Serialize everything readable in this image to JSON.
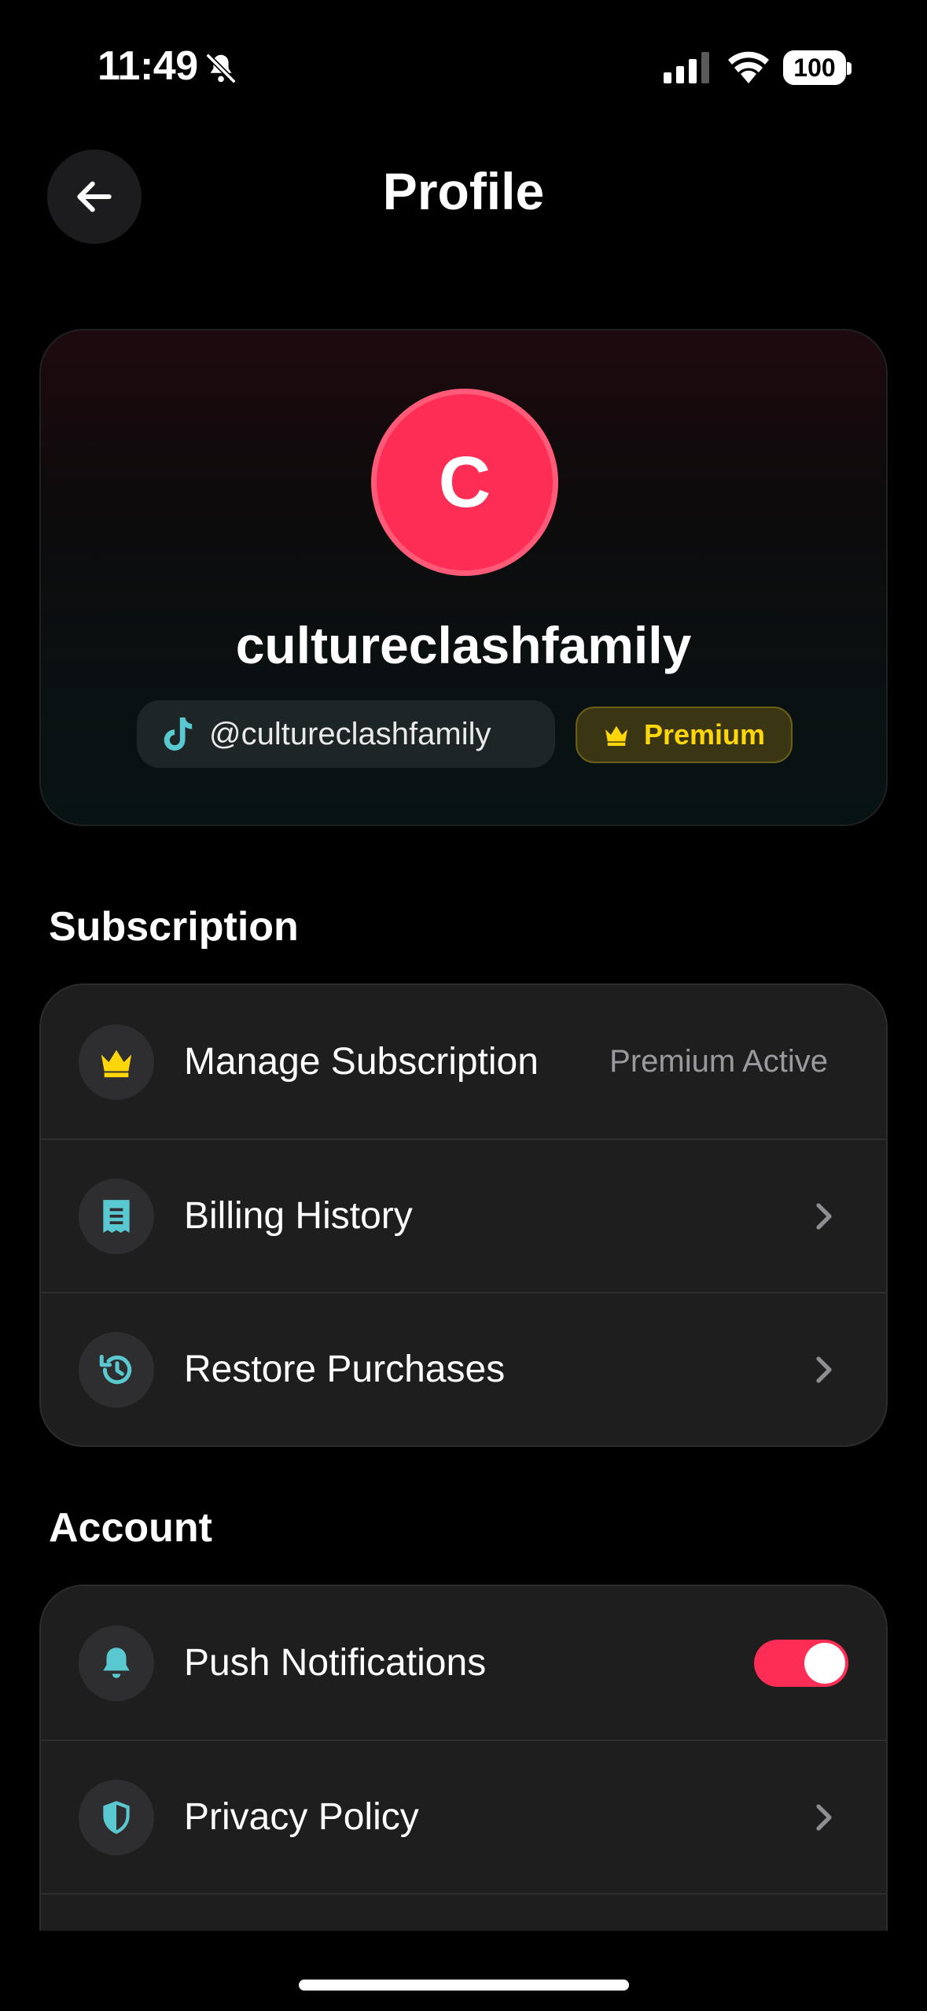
{
  "status_bar": {
    "time": "11:49",
    "battery": "100"
  },
  "header": {
    "title": "Profile"
  },
  "profile": {
    "avatar_initial": "C",
    "username": "cultureclashfamily",
    "handle": "@cultureclashfamily",
    "badge": "Premium"
  },
  "subscription": {
    "title": "Subscription",
    "items": [
      {
        "label": "Manage Subscription",
        "value": "Premium Active",
        "icon": "crown-icon"
      },
      {
        "label": "Billing History",
        "icon": "receipt-icon"
      },
      {
        "label": "Restore Purchases",
        "icon": "history-icon"
      }
    ]
  },
  "account": {
    "title": "Account",
    "items": [
      {
        "label": "Push Notifications",
        "icon": "bell-icon",
        "toggle_on": true
      },
      {
        "label": "Privacy Policy",
        "icon": "shield-icon"
      }
    ]
  },
  "colors": {
    "accent": "#fd2d55",
    "premium": "#ffd60a",
    "icon_teal": "#5ac8d0"
  }
}
